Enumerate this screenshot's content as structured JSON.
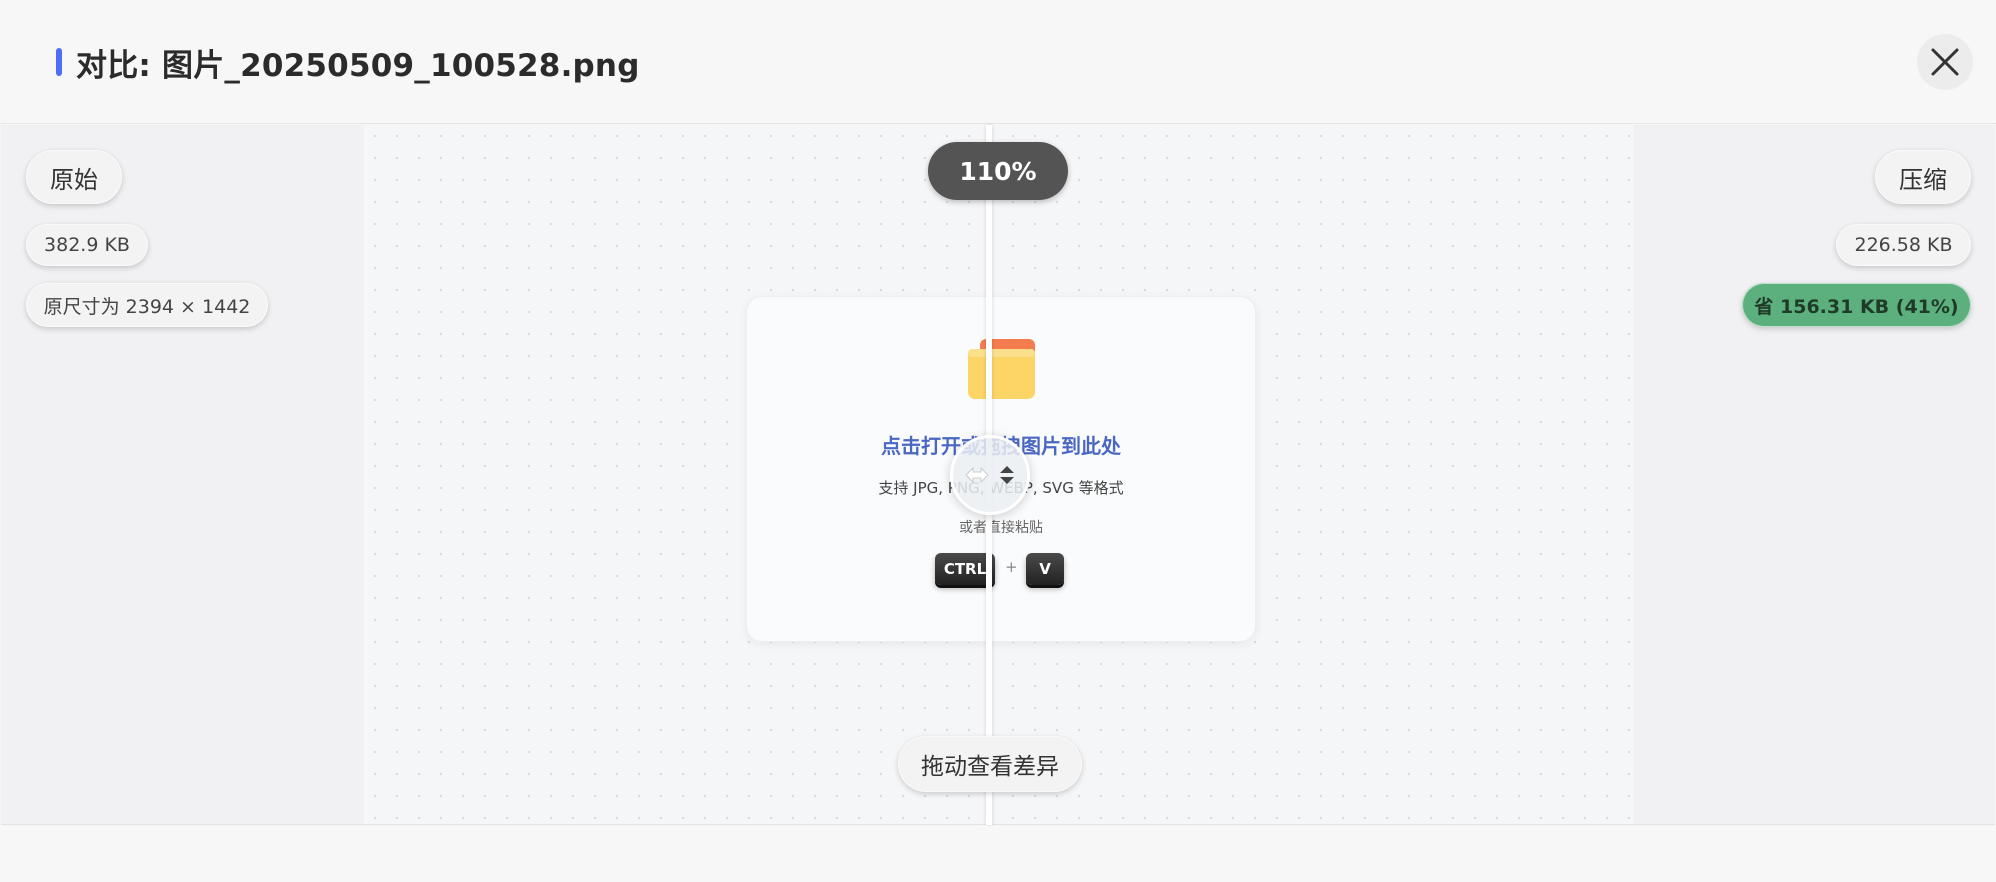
{
  "header": {
    "title": "对比: 图片_20250509_100528.png",
    "accent_color": "#4f6ef7",
    "close_icon": "close-icon"
  },
  "compare": {
    "original_label": "原始",
    "compressed_label": "压缩",
    "original_size": "382.9 KB",
    "compressed_size": "226.58 KB",
    "original_dimensions": "原尺寸为 2394 × 1442",
    "savings": "省 156.31 KB (41%)",
    "savings_color": "#5cb07e",
    "zoom": "110%",
    "drag_hint": "拖动查看差异",
    "handle_icons": [
      "arrows-horizontal-icon",
      "arrows-vertical-icon"
    ]
  },
  "preview": {
    "icon": "folder-icon",
    "title": "点击打开或拖拽图片到此处",
    "subtitle": "支持 JPG, PNG, WEBP, SVG 等格式",
    "paste_hint": "或者直接粘贴",
    "keys": [
      "CTRL",
      "V"
    ],
    "plus": "+"
  }
}
